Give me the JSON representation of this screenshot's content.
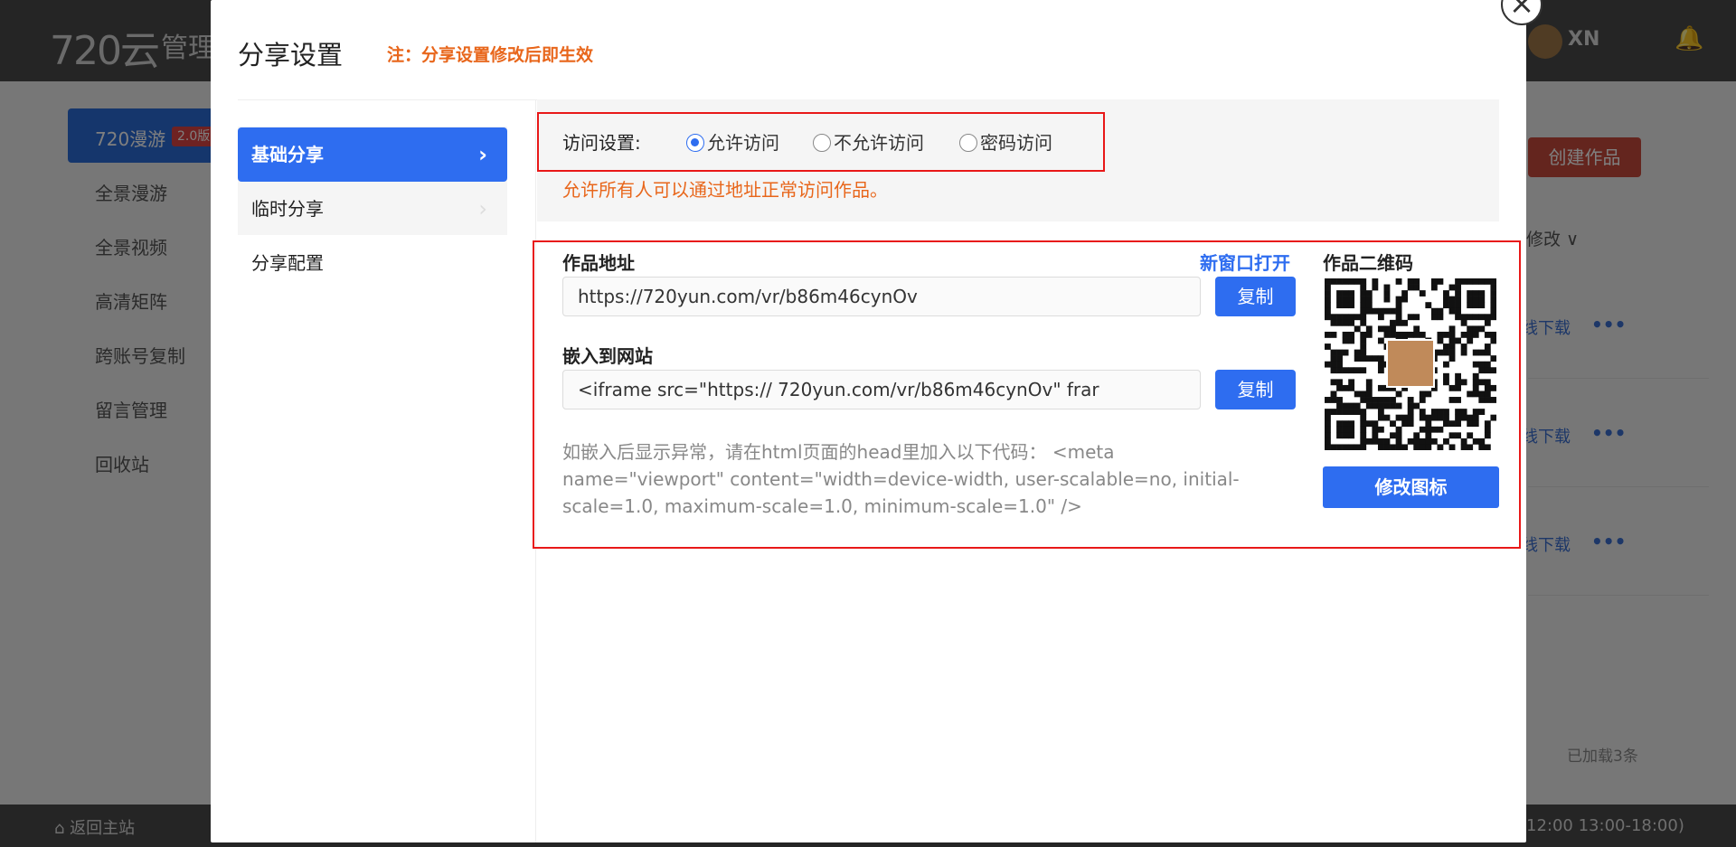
{
  "app": {
    "logo": "720云",
    "name": "管理",
    "user_name": "XN"
  },
  "sidebar": {
    "active_label": "720漫游",
    "badge": "2.0版",
    "items": [
      "全景漫游",
      "全景视频",
      "高清矩阵",
      "跨账号复制",
      "留言管理",
      "回收站"
    ]
  },
  "main": {
    "create_button": "创建作品",
    "sort_label": "修改",
    "row_link": "线下载",
    "row_more": "•••",
    "loaded_count": "已加载3条"
  },
  "footer": {
    "home_link": "返回主站",
    "hours": "12:00 13:00-18:00)"
  },
  "modal": {
    "title": "分享设置",
    "note": "注：分享设置修改后即生效",
    "close": "×",
    "tabs": [
      {
        "label": "基础分享",
        "chevron": "›"
      },
      {
        "label": "临时分享",
        "chevron": "›"
      },
      {
        "label": "分享配置"
      }
    ],
    "access": {
      "label": "访问设置:",
      "options": [
        "允许访问",
        "不允许访问",
        "密码访问"
      ],
      "selected": "允许访问",
      "description": "允许所有人可以通过地址正常访问作品。"
    },
    "link": {
      "label": "作品地址",
      "open_new": "新窗口打开",
      "url": "https://720yun.com/vr/b86m46cynOv",
      "copy": "复制"
    },
    "embed": {
      "label": "嵌入到网站",
      "code": "<iframe src=\"https:// 720yun.com/vr/b86m46cynOv\" frar",
      "copy": "复制",
      "tip": "如嵌入后显示异常，请在html页面的head里加入以下代码： <meta name=\"viewport\" content=\"width=device-width, user-scalable=no, initial-scale=1.0, maximum-scale=1.0, minimum-scale=1.0\" />"
    },
    "qr": {
      "label": "作品二维码",
      "change_icon": "修改图标"
    }
  },
  "colors": {
    "primary": "#2e6df0",
    "warning": "#e8661b",
    "highlight": "#e81818"
  }
}
